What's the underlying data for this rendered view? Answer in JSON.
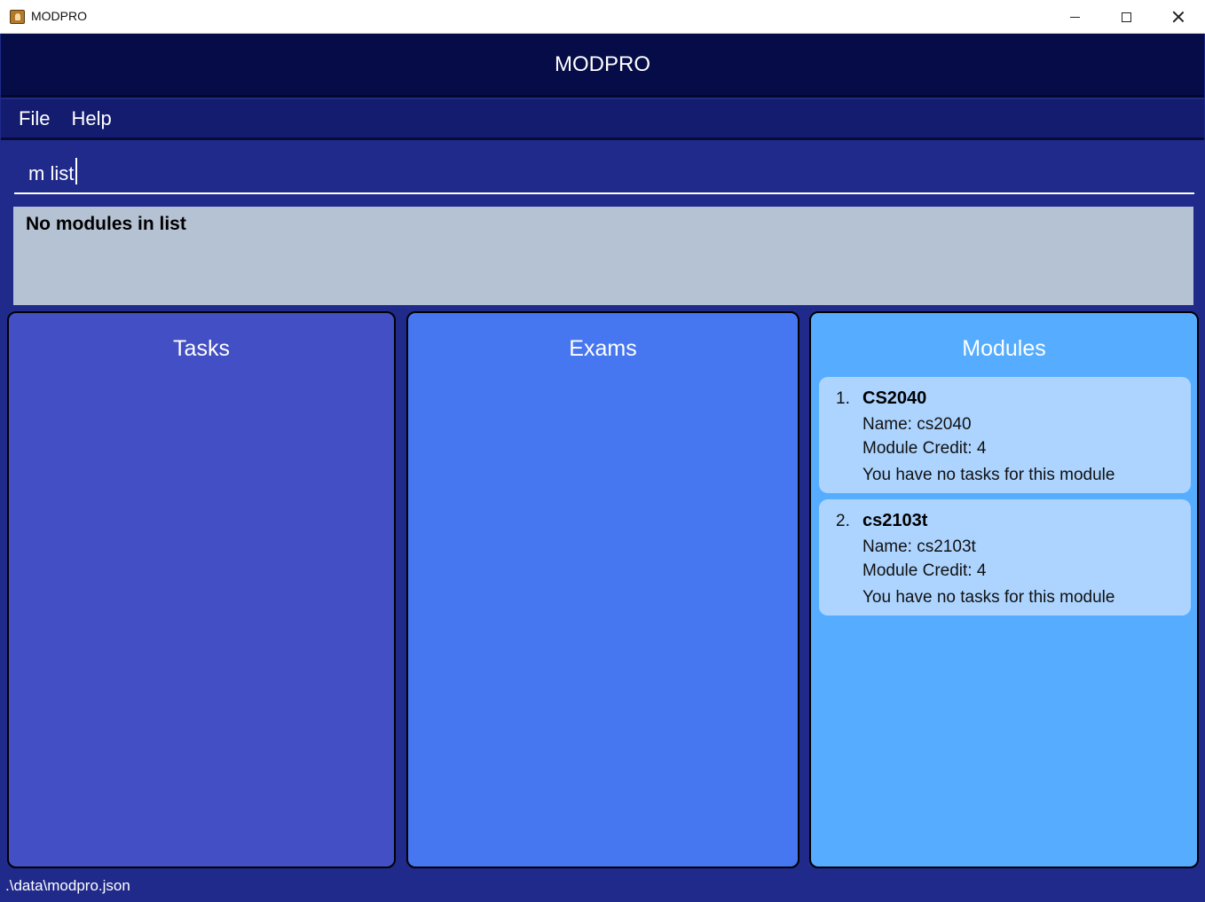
{
  "window": {
    "title": "MODPRO",
    "icon": "app-icon"
  },
  "header": {
    "title": "MODPRO"
  },
  "menu": {
    "items": [
      "File",
      "Help"
    ]
  },
  "command": {
    "value": "m list"
  },
  "result": {
    "message": "No modules in list"
  },
  "panels": {
    "tasks": {
      "title": "Tasks"
    },
    "exams": {
      "title": "Exams"
    },
    "modules": {
      "title": "Modules",
      "items": [
        {
          "index": "1.",
          "code": "CS2040",
          "name": "Name: cs2040",
          "credit": "Module Credit: 4",
          "tasks": "You have no tasks for this module"
        },
        {
          "index": "2.",
          "code": "cs2103t",
          "name": "Name: cs2103t",
          "credit": "Module Credit: 4",
          "tasks": "You have no tasks for this module"
        }
      ]
    }
  },
  "status": {
    "path": ".\\data\\modpro.json"
  },
  "colors": {
    "header": "#050c47",
    "menubar": "#131c6e",
    "background": "#1f2a8a",
    "result_box": "#b5c2d3",
    "tasks_panel": "#434fc4",
    "exams_panel": "#4777f0",
    "modules_panel": "#56adff",
    "module_card": "#acd4ff"
  }
}
